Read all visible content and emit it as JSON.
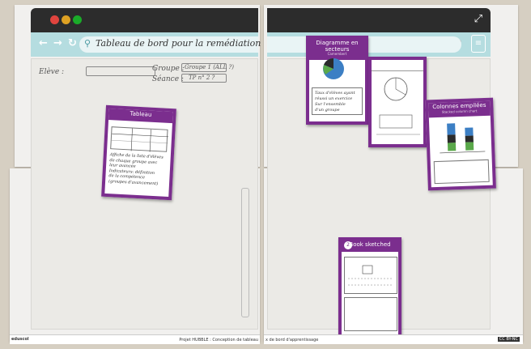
{
  "browser": {
    "address_text": "Tableau de bord pour la remédiation",
    "traffic_colors": [
      "#e0443e",
      "#dea123",
      "#1aab29"
    ],
    "nav_icons": [
      "arrow-left-icon",
      "arrow-right-icon",
      "refresh-icon",
      "home-icon",
      "search-icon"
    ]
  },
  "form_sketch": {
    "eleve_label": "Elève :",
    "groupe_label": "Groupe :",
    "groupe_value": "Groupe 1 (ALL ?)",
    "seance_label": "Séance :",
    "seance_value": "TP n° 2  ?"
  },
  "cards": {
    "tableau": {
      "title": "Tableau",
      "notes": [
        "Affiche de la liste d'élèves",
        "de chaque groupe avec",
        "leur avancée",
        "Indicateurs: définition",
        "de la compétence",
        "(groupes d'avancement)"
      ]
    },
    "secteurs": {
      "title": "Diagramme en secteurs",
      "subtitle": "Camembert",
      "notes": [
        "Taux d'élèves ayant",
        "réussi un exercice",
        "Sur l'ensemble",
        "d'un groupe"
      ]
    },
    "colonnes": {
      "title": "Colonnes empilées",
      "subtitle": "Stacked column chart"
    },
    "ressources": {
      "title": "Book sketched",
      "number": "2"
    }
  },
  "footer": {
    "left_logo": "eduscol",
    "center_left": "Projet HUBBLE : Conception de tableau",
    "center_right": "x de bord d'apprentissage",
    "license": "CC BY-NC"
  }
}
